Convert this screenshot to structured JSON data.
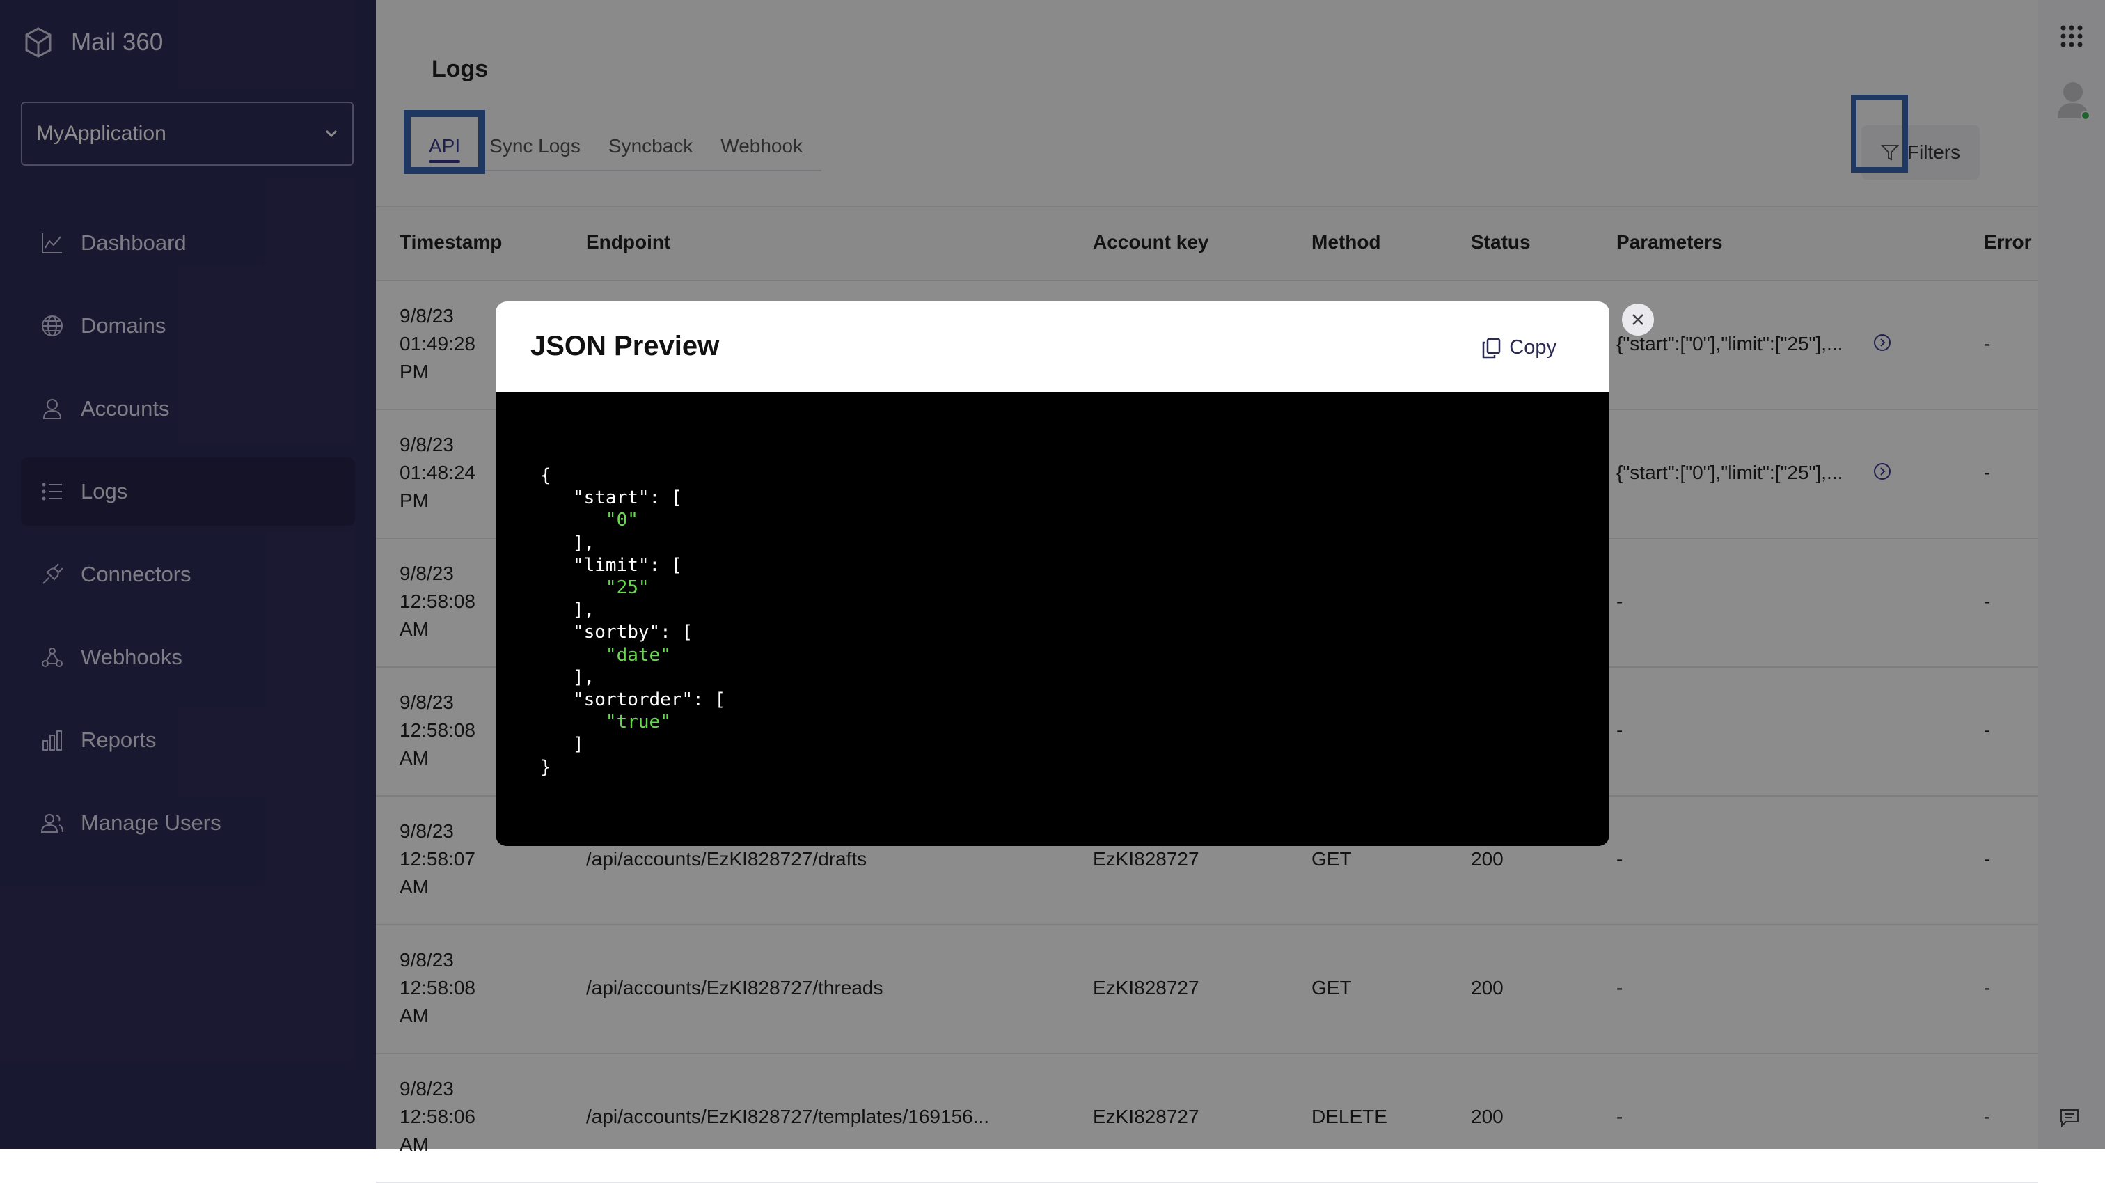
{
  "app": {
    "name": "Mail 360"
  },
  "sidebar": {
    "app_select": "MyApplication",
    "items": [
      {
        "label": "Dashboard",
        "icon": "chart-icon"
      },
      {
        "label": "Domains",
        "icon": "globe-icon"
      },
      {
        "label": "Accounts",
        "icon": "user-icon"
      },
      {
        "label": "Logs",
        "icon": "list-icon",
        "active": true
      },
      {
        "label": "Connectors",
        "icon": "plug-icon"
      },
      {
        "label": "Webhooks",
        "icon": "webhook-icon"
      },
      {
        "label": "Reports",
        "icon": "bar-chart-icon"
      },
      {
        "label": "Manage Users",
        "icon": "users-icon"
      }
    ]
  },
  "main": {
    "title": "Logs",
    "tabs": [
      "API",
      "Sync Logs",
      "Syncback",
      "Webhook"
    ],
    "active_tab": "API",
    "filters_label": "Filters",
    "columns": [
      "Timestamp",
      "Endpoint",
      "Account key",
      "Method",
      "Status",
      "Parameters",
      "Error"
    ],
    "rows": [
      {
        "date": "9/8/23",
        "time": "01:49:28",
        "ampm": "PM",
        "endpoint": "",
        "account": "",
        "method": "",
        "status": "",
        "params": "{\"start\":[\"0\"],\"limit\":[\"25\"],...",
        "error": "-"
      },
      {
        "date": "9/8/23",
        "time": "01:48:24",
        "ampm": "PM",
        "endpoint": "",
        "account": "",
        "method": "",
        "status": "",
        "params": "{\"start\":[\"0\"],\"limit\":[\"25\"],...",
        "error": "-"
      },
      {
        "date": "9/8/23",
        "time": "12:58:08",
        "ampm": "AM",
        "endpoint": "",
        "account": "",
        "method": "",
        "status": "",
        "params": "-",
        "error": "-"
      },
      {
        "date": "9/8/23",
        "time": "12:58:08",
        "ampm": "AM",
        "endpoint": "",
        "account": "",
        "method": "",
        "status": "",
        "params": "-",
        "error": "-"
      },
      {
        "date": "9/8/23",
        "time": "12:58:07",
        "ampm": "AM",
        "endpoint": "/api/accounts/EzKI828727/drafts",
        "account": "EzKI828727",
        "method": "GET",
        "status": "200",
        "params": "-",
        "error": "-"
      },
      {
        "date": "9/8/23",
        "time": "12:58:08",
        "ampm": "AM",
        "endpoint": "/api/accounts/EzKI828727/threads",
        "account": "EzKI828727",
        "method": "GET",
        "status": "200",
        "params": "-",
        "error": "-"
      },
      {
        "date": "9/8/23",
        "time": "12:58:06",
        "ampm": "AM",
        "endpoint": "/api/accounts/EzKI828727/templates/169156...",
        "account": "EzKI828727",
        "method": "DELETE",
        "status": "200",
        "params": "-",
        "error": "-"
      }
    ]
  },
  "modal": {
    "title": "JSON Preview",
    "copy_label": "Copy",
    "json": {
      "start": [
        "0"
      ],
      "limit": [
        "25"
      ],
      "sortby": [
        "date"
      ],
      "sortorder": [
        "true"
      ]
    }
  },
  "colors": {
    "sidebar_bg": "#2f2d5a",
    "accent": "#3a3a8c",
    "highlight": "#3a67b3",
    "json_string": "#68d94f"
  }
}
